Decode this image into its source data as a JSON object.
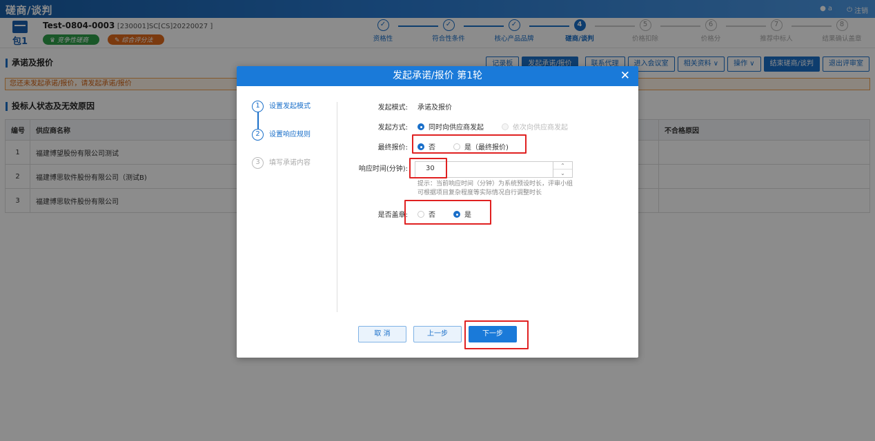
{
  "app": {
    "title": "磋商/谈判",
    "user": "a",
    "logout": "注销"
  },
  "header": {
    "package_label": "包1",
    "project_code": "Test-0804-0003",
    "project_meta": " [230001]SC[CS]20220027 ]",
    "tags": [
      "竞争性磋商",
      "综合评分法"
    ]
  },
  "steps": [
    {
      "n": "✓",
      "label": "资格性",
      "state": "done"
    },
    {
      "n": "✓",
      "label": "符合性条件",
      "state": "done"
    },
    {
      "n": "✓",
      "label": "核心产品品牌",
      "state": "done"
    },
    {
      "n": "4",
      "label": "磋商/谈判",
      "state": "active"
    },
    {
      "n": "5",
      "label": "价格扣除",
      "state": "todo"
    },
    {
      "n": "6",
      "label": "价格分",
      "state": "todo"
    },
    {
      "n": "7",
      "label": "推荐中标人",
      "state": "todo"
    },
    {
      "n": "8",
      "label": "结果确认盖章",
      "state": "todo"
    }
  ],
  "section": {
    "title": "承诺及报价",
    "warning": "您还未发起承诺/报价，请发起承诺/报价",
    "bidder_title": "投标人状态及无效原因"
  },
  "toolbar": [
    "记录板",
    "发起承诺/报价",
    "联系代理",
    "进入会议室",
    "相关资料 ∨",
    "操作 ∨",
    "结束磋商/谈判",
    "退出评审室"
  ],
  "table": {
    "headers": [
      "编号",
      "供应商名称",
      "不合格原因"
    ],
    "rows": [
      [
        "1",
        "福建博望股份有限公司测试",
        ""
      ],
      [
        "2",
        "福建博思软件股份有限公司（测试B)",
        ""
      ],
      [
        "3",
        "福建博思软件股份有限公司",
        ""
      ]
    ]
  },
  "modal": {
    "title": "发起承诺/报价 第1轮",
    "close": "✕",
    "wizard": [
      {
        "n": "1",
        "label": "设置发起模式",
        "state": "done"
      },
      {
        "n": "2",
        "label": "设置响应规则",
        "state": "active"
      },
      {
        "n": "3",
        "label": "填写承诺内容",
        "state": "todo"
      }
    ],
    "mode_label": "发起模式:",
    "mode_value": "承诺及报价",
    "method_label": "发起方式:",
    "method_options": [
      "同时向供应商发起",
      "依次向供应商发起"
    ],
    "final_label": "最终报价:",
    "final_options": [
      "否",
      "是（最终报价)"
    ],
    "time_label": "响应时间(分钟):",
    "time_value": "30",
    "hint": "提示：当前响应时间（分钟）为系统预设时长，评审小组可根据项目复杂程度等实际情况自行调整时长",
    "seal_label": "是否盖章:",
    "seal_options": [
      "否",
      "是"
    ],
    "buttons": {
      "cancel": "取 消",
      "prev": "上一步",
      "next": "下一步"
    }
  }
}
